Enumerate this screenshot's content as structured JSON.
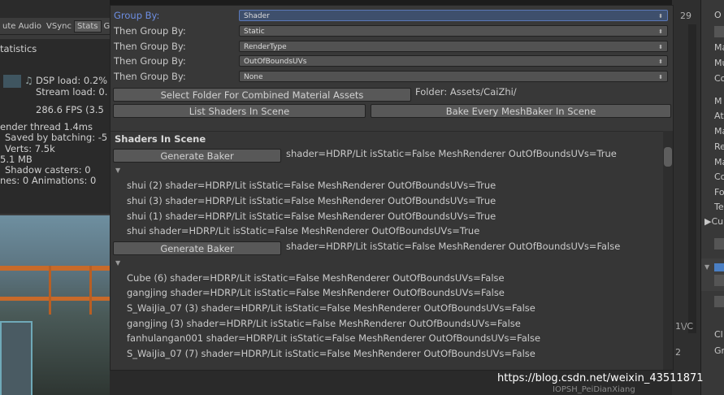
{
  "game_view": {
    "toolbar_items": [
      "ute Audio",
      "VSync",
      "Stats",
      "G"
    ],
    "statistics_title": "tatistics",
    "dsp_load": "DSP load: 0.2%",
    "stream_load": "Stream load: 0.",
    "fps": "286.6 FPS (3.5",
    "render_thread": "ender thread 1.4ms",
    "saved_batching": "Saved by batching: -5",
    "verts": "Verts: 7.5k",
    "mb": "5.1 MB",
    "shadow_casters": "Shadow casters: 0",
    "animations": "nes: 0  Animations: 0"
  },
  "mid_strip": {
    "top_number": "29",
    "vc_label": "1\\/C",
    "bottom_number": "2"
  },
  "inspector": {
    "letters": [
      "O",
      "Ma",
      "Mu",
      "Co",
      "M",
      "At",
      "Ma",
      "Re",
      "Ma",
      "Co",
      "Fo",
      "Te",
      "Cu",
      "Cl",
      "Gr"
    ]
  },
  "grouping": {
    "rows": [
      {
        "label": "Group By:",
        "value": "Shader"
      },
      {
        "label": "Then Group By:",
        "value": "Static"
      },
      {
        "label": "Then Group By:",
        "value": "RenderType"
      },
      {
        "label": "Then Group By:",
        "value": "OutOfBoundsUVs"
      },
      {
        "label": "Then Group By:",
        "value": "None"
      }
    ],
    "arrow": "⬍"
  },
  "actions": {
    "select_folder": "Select Folder For Combined Material Assets",
    "folder_label": "Folder: Assets/CaiZhi/",
    "list_shaders": "List Shaders In Scene",
    "bake_every": "Bake Every MeshBaker In Scene"
  },
  "shaders": {
    "title": "Shaders In Scene",
    "groups": [
      {
        "button": "Generate Baker",
        "header": "shader=HDRP/Lit isStatic=False MeshRenderer OutOfBoundsUVs=True",
        "items": [
          "shui (2)  shader=HDRP/Lit isStatic=False MeshRenderer OutOfBoundsUVs=True",
          "shui (3)  shader=HDRP/Lit isStatic=False MeshRenderer OutOfBoundsUVs=True",
          "shui (1)  shader=HDRP/Lit isStatic=False MeshRenderer OutOfBoundsUVs=True",
          "shui  shader=HDRP/Lit isStatic=False MeshRenderer OutOfBoundsUVs=True"
        ]
      },
      {
        "button": "Generate Baker",
        "header": "shader=HDRP/Lit isStatic=False MeshRenderer OutOfBoundsUVs=False",
        "items": [
          "Cube (6)  shader=HDRP/Lit isStatic=False MeshRenderer OutOfBoundsUVs=False",
          "gangjing  shader=HDRP/Lit isStatic=False MeshRenderer OutOfBoundsUVs=False",
          "S_WaiJia_07 (3)  shader=HDRP/Lit isStatic=False MeshRenderer OutOfBoundsUVs=False",
          "gangjing (3)  shader=HDRP/Lit isStatic=False MeshRenderer OutOfBoundsUVs=False",
          "fanhulangan001  shader=HDRP/Lit isStatic=False MeshRenderer OutOfBoundsUVs=False",
          "S_WaiJia_07 (7)  shader=HDRP/Lit isStatic=False MeshRenderer OutOfBoundsUVs=False"
        ]
      }
    ]
  },
  "watermark": "https://blog.csdn.net/weixin_43511871",
  "bottom_faint": "IOPSH_PeiDianXiang"
}
